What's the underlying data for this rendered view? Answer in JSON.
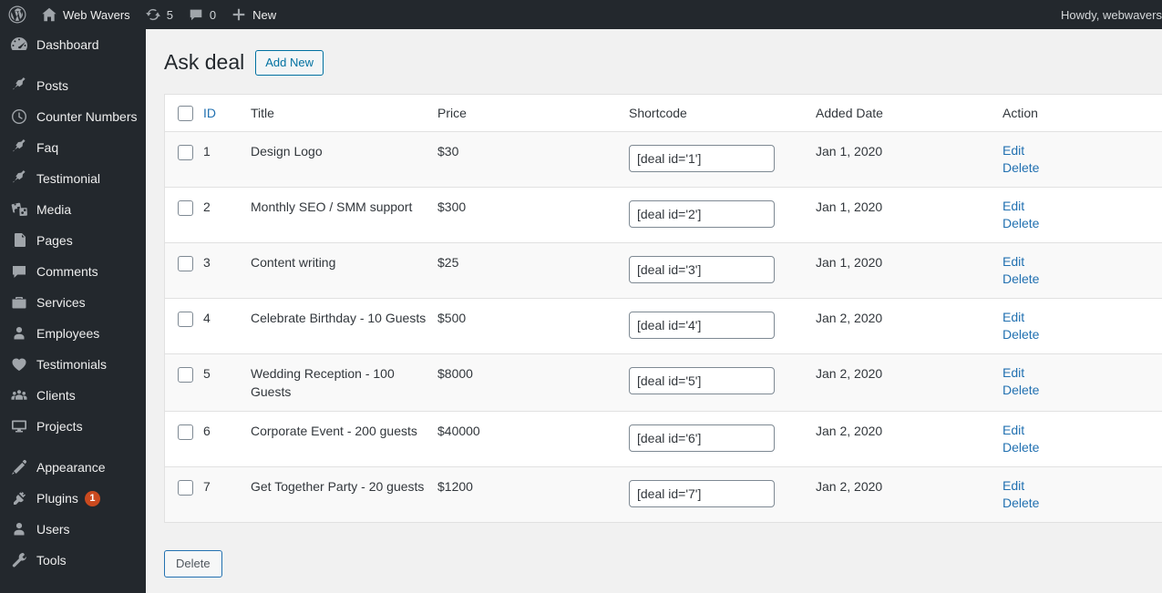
{
  "adminbar": {
    "wp_logo_icon": "wordpress-logo-icon",
    "site_home_icon": "home-icon",
    "site_name": "Web Wavers",
    "updates_icon": "updates-icon",
    "updates_count": "5",
    "comments_icon": "comment-bubble-icon",
    "comments_count": "0",
    "new_icon": "plus-icon",
    "new_label": "New",
    "howdy": "Howdy, webwavers"
  },
  "sidebar": {
    "items": [
      {
        "label": "Dashboard",
        "icon": "dashboard-icon",
        "sep_after": true
      },
      {
        "label": "Posts",
        "icon": "pin-icon"
      },
      {
        "label": "Counter Numbers",
        "icon": "clock-icon"
      },
      {
        "label": "Faq",
        "icon": "pin-icon"
      },
      {
        "label": "Testimonial",
        "icon": "pin-icon"
      },
      {
        "label": "Media",
        "icon": "media-icon"
      },
      {
        "label": "Pages",
        "icon": "pages-icon"
      },
      {
        "label": "Comments",
        "icon": "comment-bubble-icon"
      },
      {
        "label": "Services",
        "icon": "portfolio-icon"
      },
      {
        "label": "Employees",
        "icon": "user-icon"
      },
      {
        "label": "Testimonials",
        "icon": "heart-icon"
      },
      {
        "label": "Clients",
        "icon": "groups-icon"
      },
      {
        "label": "Projects",
        "icon": "desktop-icon",
        "sep_after": true
      },
      {
        "label": "Appearance",
        "icon": "brush-icon"
      },
      {
        "label": "Plugins",
        "icon": "plugin-icon",
        "badge": "1"
      },
      {
        "label": "Users",
        "icon": "user-icon"
      },
      {
        "label": "Tools",
        "icon": "wrench-icon"
      }
    ]
  },
  "page": {
    "title": "Ask deal",
    "add_new_label": "Add New",
    "bulk_delete_label": "Delete"
  },
  "table": {
    "headers": {
      "select_all": "",
      "id": "ID",
      "title": "Title",
      "price": "Price",
      "shortcode": "Shortcode",
      "added_date": "Added Date",
      "action": "Action"
    },
    "actions": {
      "edit": "Edit",
      "delete": "Delete"
    },
    "rows": [
      {
        "id": "1",
        "title": "Design Logo",
        "price": "$30",
        "shortcode": "[deal id='1']",
        "date": "Jan 1, 2020"
      },
      {
        "id": "2",
        "title": "Monthly SEO / SMM support",
        "price": "$300",
        "shortcode": "[deal id='2']",
        "date": "Jan 1, 2020"
      },
      {
        "id": "3",
        "title": "Content writing",
        "price": "$25",
        "shortcode": "[deal id='3']",
        "date": "Jan 1, 2020"
      },
      {
        "id": "4",
        "title": "Celebrate Birthday - 10 Guests",
        "price": "$500",
        "shortcode": "[deal id='4']",
        "date": "Jan 2, 2020"
      },
      {
        "id": "5",
        "title": "Wedding Reception - 100 Guests",
        "price": "$8000",
        "shortcode": "[deal id='5']",
        "date": "Jan 2, 2020"
      },
      {
        "id": "6",
        "title": "Corporate Event - 200 guests",
        "price": "$40000",
        "shortcode": "[deal id='6']",
        "date": "Jan 2, 2020"
      },
      {
        "id": "7",
        "title": "Get Together Party - 20 guests",
        "price": "$1200",
        "shortcode": "[deal id='7']",
        "date": "Jan 2, 2020"
      }
    ]
  },
  "colors": {
    "adminbar_bg": "#23282d",
    "sidebar_bg": "#23282d",
    "content_bg": "#f1f1f1",
    "link_blue": "#2271b1",
    "button_blue": "#0071a1",
    "badge_orange": "#ca4a1f",
    "row_stripe": "#f9f9f9"
  }
}
